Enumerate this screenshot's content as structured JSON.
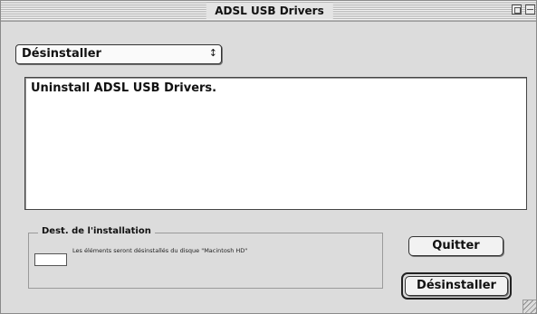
{
  "window": {
    "title": "ADSL USB Drivers"
  },
  "install_mode": {
    "selected": "Désinstaller",
    "arrow_glyph": "↕"
  },
  "description": {
    "text": "Uninstall ADSL USB Drivers."
  },
  "destination": {
    "legend": "Dest. de l'installation",
    "message": "Les éléments seront désinstallés du disque \"Macintosh HD\""
  },
  "buttons": {
    "quit": "Quitter",
    "uninstall": "Désinstaller"
  }
}
